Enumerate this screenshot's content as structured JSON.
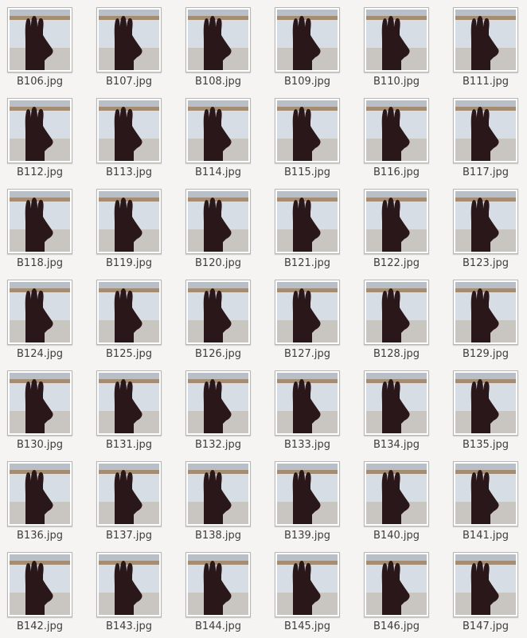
{
  "window": {
    "view": "icon-grid",
    "accent": "#f5f4f3"
  },
  "thumbnail": {
    "icon": "hand-photo-icon",
    "colors": {
      "wall_top": "#b9bfc6",
      "shelf": "#a58d73",
      "wall": "#d7dde4",
      "floor": "#c9c6c1",
      "hand": "#2a1719"
    }
  },
  "files": [
    {
      "name": "B106.jpg"
    },
    {
      "name": "B107.jpg"
    },
    {
      "name": "B108.jpg"
    },
    {
      "name": "B109.jpg"
    },
    {
      "name": "B110.jpg"
    },
    {
      "name": "B111.jpg"
    },
    {
      "name": "B112.jpg"
    },
    {
      "name": "B113.jpg"
    },
    {
      "name": "B114.jpg"
    },
    {
      "name": "B115.jpg"
    },
    {
      "name": "B116.jpg"
    },
    {
      "name": "B117.jpg"
    },
    {
      "name": "B118.jpg"
    },
    {
      "name": "B119.jpg"
    },
    {
      "name": "B120.jpg"
    },
    {
      "name": "B121.jpg"
    },
    {
      "name": "B122.jpg"
    },
    {
      "name": "B123.jpg"
    },
    {
      "name": "B124.jpg"
    },
    {
      "name": "B125.jpg"
    },
    {
      "name": "B126.jpg"
    },
    {
      "name": "B127.jpg"
    },
    {
      "name": "B128.jpg"
    },
    {
      "name": "B129.jpg"
    },
    {
      "name": "B130.jpg"
    },
    {
      "name": "B131.jpg"
    },
    {
      "name": "B132.jpg"
    },
    {
      "name": "B133.jpg"
    },
    {
      "name": "B134.jpg"
    },
    {
      "name": "B135.jpg"
    },
    {
      "name": "B136.jpg"
    },
    {
      "name": "B137.jpg"
    },
    {
      "name": "B138.jpg"
    },
    {
      "name": "B139.jpg"
    },
    {
      "name": "B140.jpg"
    },
    {
      "name": "B141.jpg"
    },
    {
      "name": "B142.jpg"
    },
    {
      "name": "B143.jpg"
    },
    {
      "name": "B144.jpg"
    },
    {
      "name": "B145.jpg"
    },
    {
      "name": "B146.jpg"
    },
    {
      "name": "B147.jpg"
    }
  ]
}
